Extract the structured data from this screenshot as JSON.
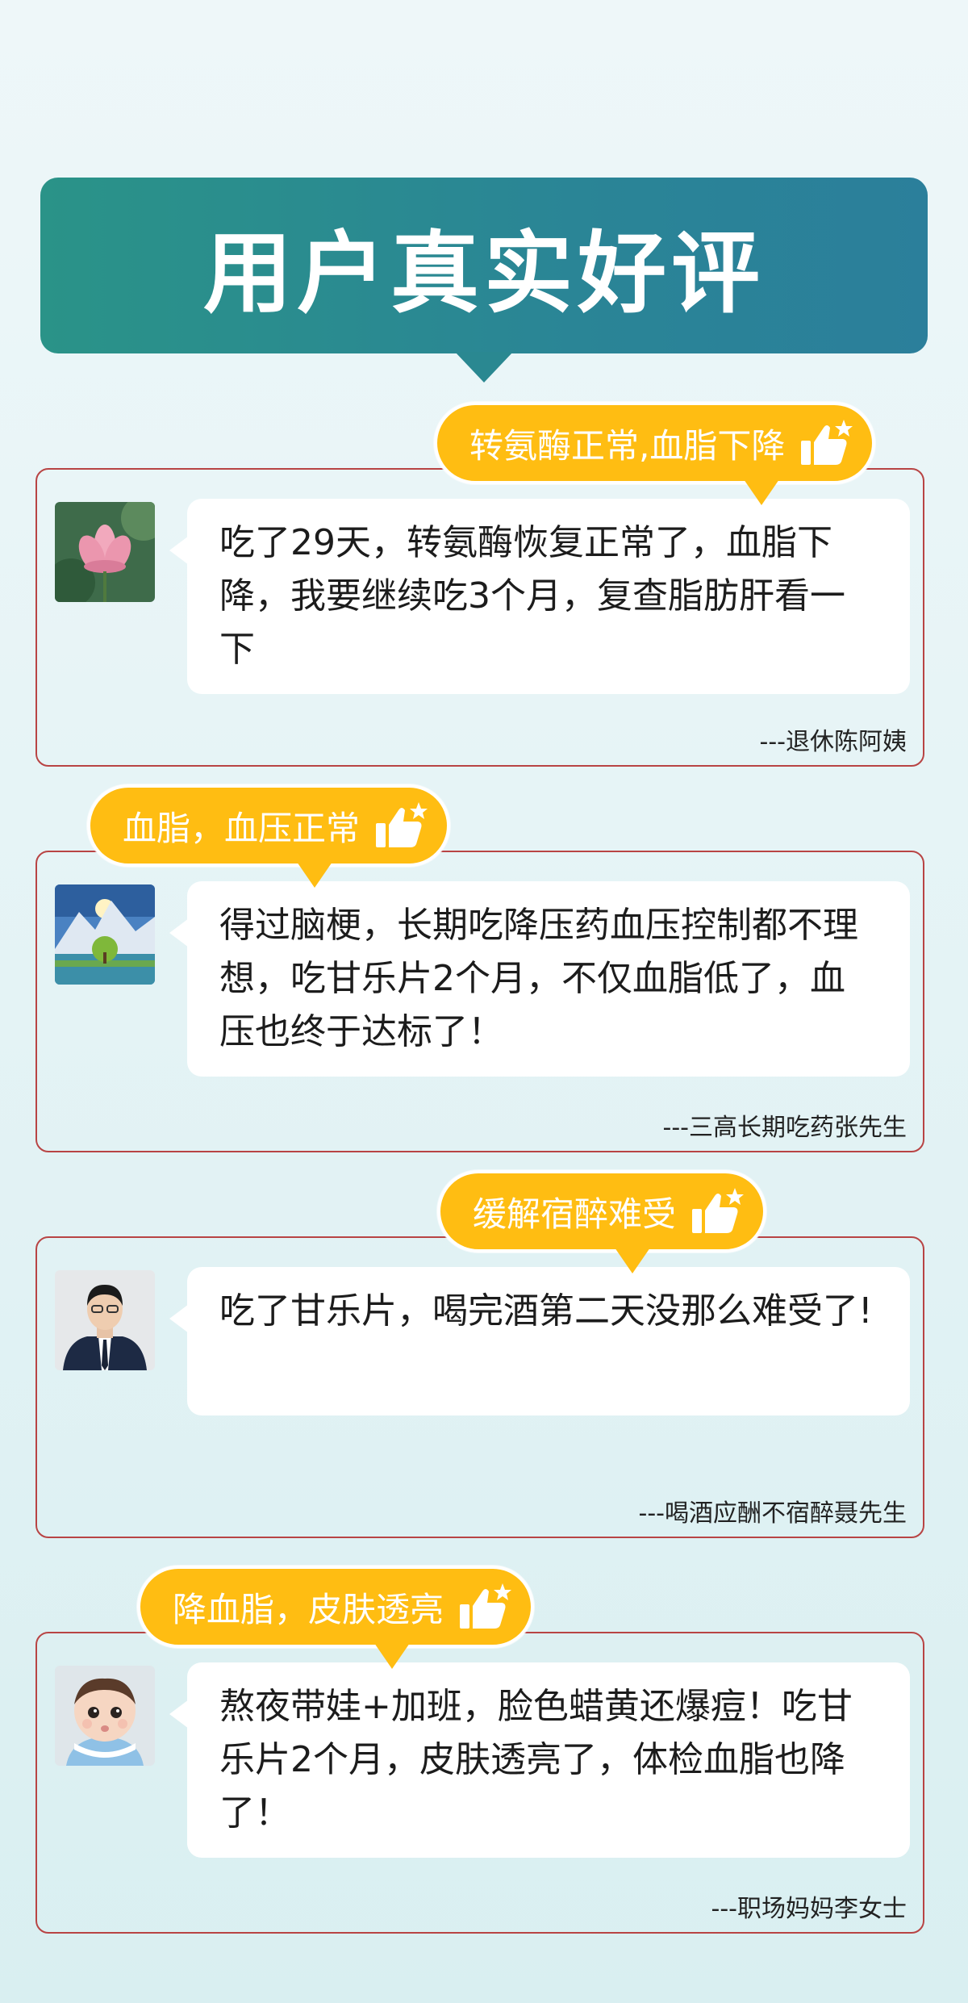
{
  "header": {
    "title": "用户真实好评"
  },
  "reviews": [
    {
      "tag": "转氨酶正常,血脂下降",
      "text": "吃了29天，转氨酶恢复正常了，血脂下降，我要继续吃3个月，复查脂肪肝看一下",
      "author": "---退休陈阿姨",
      "avatar": "lotus-avatar"
    },
    {
      "tag": "血脂，血压正常",
      "text": "得过脑梗，长期吃降压药血压控制都不理想，吃甘乐片2个月，不仅血脂低了，血压也终于达标了！",
      "author": "---三高长期吃药张先生",
      "avatar": "mountain-avatar"
    },
    {
      "tag": "缓解宿醉难受",
      "text": "吃了甘乐片，喝完酒第二天没那么难受了!",
      "author": "---喝酒应酬不宿醉聂先生",
      "avatar": "man-in-suit-avatar"
    },
    {
      "tag": "降血脂，皮肤透亮",
      "text": "熬夜带娃+加班，脸色蜡黄还爆痘！吃甘乐片2个月，皮肤透亮了，体检血脂也降了！",
      "author": "---职场妈妈李女士",
      "avatar": "baby-avatar"
    }
  ],
  "colors": {
    "header_bg": "#2a8a92",
    "tag_bg": "#ffbd12",
    "card_border": "#b84444"
  }
}
